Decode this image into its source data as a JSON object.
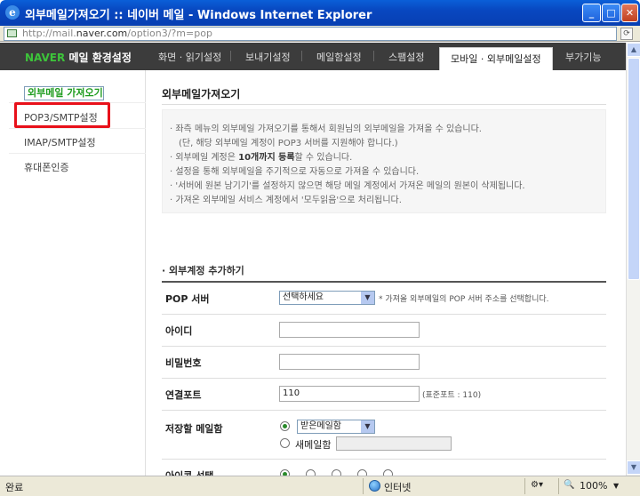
{
  "window": {
    "title": "외부메일가져오기 :: 네이버 메일 - Windows Internet Explorer",
    "address_prefix": "http://mail.",
    "address_host": "naver.com",
    "address_suffix": "/option3/?m=pop"
  },
  "nav": {
    "brand_logo": "NAVER",
    "brand_title": "메일 환경설정",
    "tabs": [
      "화면 · 읽기설정",
      "보내기설정",
      "메일함설정",
      "스팸설정",
      "모바일 · 외부메일설정",
      "부가기능"
    ],
    "active_tab_index": 4
  },
  "sidebar": {
    "items": [
      {
        "label": "외부메일 가져오기"
      },
      {
        "label": "POP3/SMTP설정"
      },
      {
        "label": "IMAP/SMTP설정"
      },
      {
        "label": "휴대폰인증"
      }
    ]
  },
  "main": {
    "heading": "외부메일가져오기",
    "info_lines": [
      "좌측 메뉴의 외부메일 가져오기를 통해서 회원님의 외부메일을 가져올 수 있습니다.",
      "(단, 해당 외부메일 계정이 POP3 서버를 지원해야 합니다.)",
      "외부메일 계정은 ",
      "10개까지 등록",
      "할 수 있습니다.",
      "설정을 통해 외부메일을 주기적으로 자동으로 가져올 수 있습니다.",
      "'서버에 원본 남기기'를 설정하지 않으면 해당 메일 계정에서 가져온 메일의 원본이 삭제됩니다.",
      "가져온 외부메일 서비스 계정에서 '모두읽음'으로 처리됩니다."
    ],
    "section_title": "외부계정 추가하기",
    "form": {
      "pop_server_label": "POP 서버",
      "pop_server_select": "선택하세요",
      "pop_server_hint": "* 가져올 외부메일의 POP 서버 주소를 선택합니다.",
      "id_label": "아이디",
      "password_label": "비밀번호",
      "port_label": "연결포트",
      "port_value": "110",
      "port_hint": "(표준포트 : 110)",
      "mailbox_label": "저장할 메일함",
      "mailbox_select": "받은메일함",
      "new_mailbox_label": "새메일함",
      "icon_label": "아이콘 선택"
    }
  },
  "status": {
    "left": "완료",
    "zone": "인터넷",
    "zoom": "100%"
  },
  "colors": {
    "titlebar": "#0847c0",
    "navbar": "#3c3c3c",
    "brand_green": "#3dc43a",
    "sidebar_selected": "#1f9c1f",
    "highlight_box": "#e8101a"
  }
}
